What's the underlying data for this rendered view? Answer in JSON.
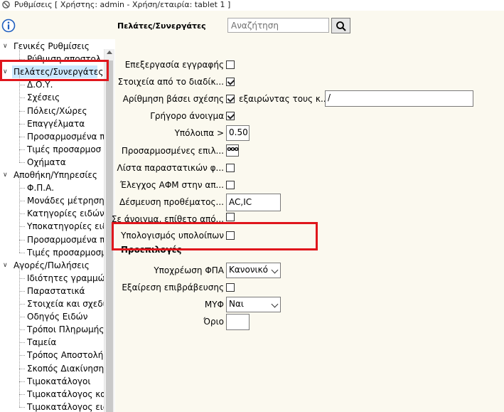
{
  "window": {
    "title": "Ρυθμίσεις  [ Χρήστης: admin - Χρήση/εταιρία: tablet 1 ]",
    "icon": "settings-app-icon"
  },
  "toolbar": {
    "info_icon": "info-icon"
  },
  "tree": {
    "groups": [
      {
        "label": "Γενικές Ρυθμίσεις",
        "expanded": true,
        "children": [
          "Ρύθμιση αποστολ"
        ]
      },
      {
        "label": "Πελάτες/Συνεργάτες",
        "expanded": true,
        "selected": true,
        "children": [
          "Δ.Ο.Υ.",
          "Σχέσεις",
          "Πόλεις/Χώρες",
          "Επαγγέλματα",
          "Προσαρμοσμένα π",
          "Τιμές προσαρμοσ",
          "Οχήματα"
        ]
      },
      {
        "label": "Αποθήκη/Υπηρεσίες",
        "expanded": true,
        "children": [
          "Φ.Π.Α.",
          "Μονάδες μέτρησης",
          "Κατηγορίες ειδών",
          "Υποκατηγορίες ειδ",
          "Προσαρμοσμένα π",
          "Τιμές προσαρμοσμ"
        ]
      },
      {
        "label": "Αγορές/Πωλήσεις",
        "expanded": true,
        "children": [
          "Ιδιότητες γραμμών",
          "Παραστατικά",
          "Στοιχεία και σχεδι",
          "Οδηγός Ειδών",
          "Τρόποι Πληρωμής",
          "Ταμεία",
          "Τρόπος Αποστολή",
          "Σκοπός Διακίνηση",
          "Τιμοκατάλογοι",
          "Τιμοκατάλογος κα",
          "Τιμοκατάλογος ειδ"
        ]
      }
    ]
  },
  "header": {
    "section_title": "Πελάτες/Συνεργάτες",
    "search_placeholder": "Αναζήτηση",
    "search_icon": "search-icon"
  },
  "form": {
    "edit_record_label": "Επεξεργασία εγγραφής",
    "edit_record_checked": false,
    "data_from_process_label": "Στοιχεία από το διαδίκ...",
    "data_from_process_checked": true,
    "numbering_by_relation_label": "Αρίθμηση βάσει σχέσης",
    "numbering_by_relation_checked": true,
    "excluding_label": "εξαιρώντας τους κ...",
    "excluding_value": "/",
    "quick_open_label": "Γρήγορο άνοιγμα",
    "quick_open_checked": true,
    "balances_label": "Υπόλοιπα >",
    "balances_value": "0.50",
    "custom_options_label": "Προσαρμοσμένες επιλ...",
    "custom_options_button": "ooo",
    "doc_list_label": "Λίστα παραστατικών φ...",
    "doc_list_checked": false,
    "vat_check_label": "Έλεγχος ΑΦΜ στην απ...",
    "vat_check_checked": false,
    "prefix_binding_label": "Δέσμευση προθέματος...",
    "prefix_binding_value": "AC,IC",
    "on_open_label": "Σε άνοιγμα, επίθετο από...",
    "on_open_checked": false,
    "calc_balances_label": "Υπολογισμός υπολοίπων",
    "calc_balances_checked": false
  },
  "defaults": {
    "section_title": "Προεπιλογές",
    "vat_obligation_label": "Υποχρέωση ΦΠΑ",
    "vat_obligation_value": "Κανονικό",
    "verification_exempt_label": "Εξαίρεση επιβράβευσης",
    "verification_exempt_checked": false,
    "myf_label": "ΜΥΦ",
    "myf_value": "Ναι",
    "limit_label": "Όριο",
    "limit_value": ""
  },
  "highlights": {
    "color": "#e0161c"
  }
}
